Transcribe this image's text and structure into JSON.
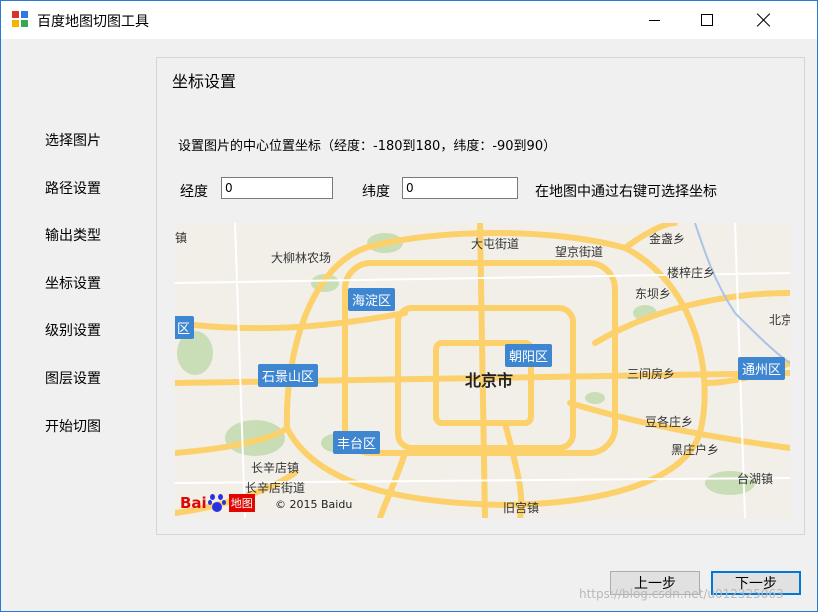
{
  "window": {
    "title": "百度地图切图工具",
    "icon": "app-map-icon",
    "controls": {
      "minimize": "minimize-icon",
      "maximize": "maximize-icon",
      "close": "close-icon"
    }
  },
  "nav": {
    "items": [
      {
        "label": "选择图片"
      },
      {
        "label": "路径设置"
      },
      {
        "label": "输出类型"
      },
      {
        "label": "坐标设置"
      },
      {
        "label": "级别设置"
      },
      {
        "label": "图层设置"
      },
      {
        "label": "开始切图"
      }
    ]
  },
  "panel": {
    "title": "坐标设置",
    "description": "设置图片的中心位置坐标（经度：-180到180，纬度：-90到90）",
    "longitude": {
      "label": "经度",
      "value": "0"
    },
    "latitude": {
      "label": "纬度",
      "value": "0"
    },
    "hint": "在地图中通过右键可选择坐标"
  },
  "map": {
    "labels": [
      "大屯街道",
      "望京街道",
      "金盏乡",
      "大柳林农场",
      "楼梓庄乡",
      "东坝乡",
      "北京市",
      "三间房乡",
      "豆各庄乡",
      "黑庄户乡",
      "长辛店镇",
      "长辛店街道",
      "台湖镇",
      "旧宫镇",
      "北京",
      "镇"
    ],
    "districts": [
      "海淀区",
      "朝阳区",
      "石景山区",
      "丰台区",
      "通州区",
      "区"
    ],
    "logo": {
      "bai": "Bai",
      "map": "地图"
    },
    "copyright": "© 2015 Baidu"
  },
  "buttons": {
    "prev": "上一步",
    "next": "下一步"
  },
  "watermark": "https://blog.csdn.net/u012325063",
  "colors": {
    "accent": "#0078d7",
    "district": "#3f86d1",
    "road": "#fcd16b",
    "baidu_red": "#e10601",
    "baidu_blue": "#2932e1"
  }
}
